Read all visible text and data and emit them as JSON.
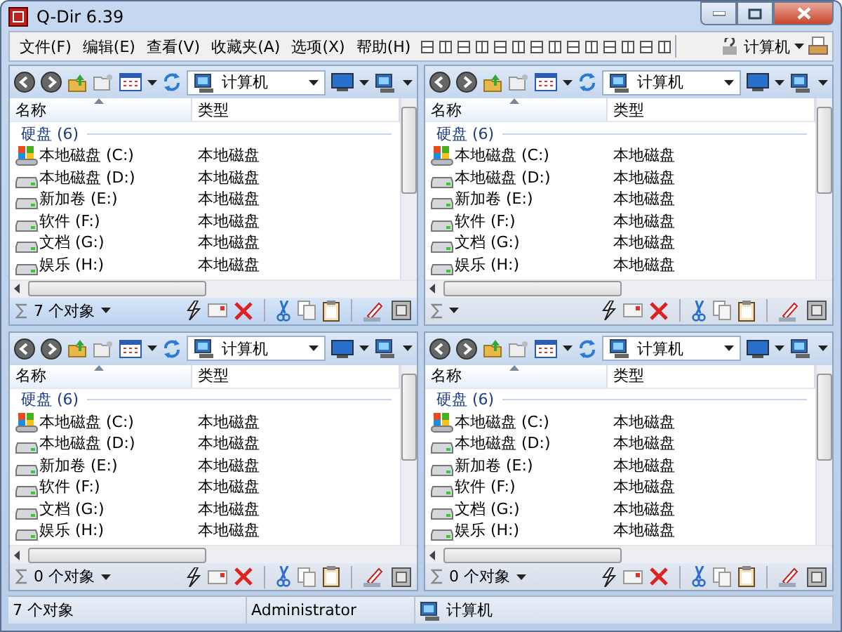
{
  "window": {
    "title": "Q-Dir 6.39"
  },
  "menu": [
    {
      "label": "文件(F)"
    },
    {
      "label": "编辑(E)"
    },
    {
      "label": "查看(V)"
    },
    {
      "label": "收藏夹(A)"
    },
    {
      "label": "选项(X)"
    },
    {
      "label": "帮助(H)"
    }
  ],
  "view_switch": {
    "label": "计算机"
  },
  "panes": [
    {
      "selected": true,
      "address": "计算机",
      "columns": [
        "名称",
        "类型"
      ],
      "group": "硬盘 (6)",
      "count": "7 个对象",
      "rows": [
        {
          "name": "本地磁盘 (C:)",
          "type": "本地磁盘",
          "kind": "system"
        },
        {
          "name": "本地磁盘 (D:)",
          "type": "本地磁盘",
          "kind": "drive"
        },
        {
          "name": "新加卷 (E:)",
          "type": "本地磁盘",
          "kind": "drive"
        },
        {
          "name": "软件 (F:)",
          "type": "本地磁盘",
          "kind": "drive"
        },
        {
          "name": "文档 (G:)",
          "type": "本地磁盘",
          "kind": "drive"
        },
        {
          "name": "娱乐 (H:)",
          "type": "本地磁盘",
          "kind": "drive"
        }
      ]
    },
    {
      "selected": false,
      "address": "计算机",
      "columns": [
        "名称",
        "类型"
      ],
      "group": "硬盘 (6)",
      "rows": [
        {
          "name": "本地磁盘 (C:)",
          "type": "本地磁盘",
          "kind": "system"
        },
        {
          "name": "本地磁盘 (D:)",
          "type": "本地磁盘",
          "kind": "drive"
        },
        {
          "name": "新加卷 (E:)",
          "type": "本地磁盘",
          "kind": "drive"
        },
        {
          "name": "软件 (F:)",
          "type": "本地磁盘",
          "kind": "drive"
        },
        {
          "name": "文档 (G:)",
          "type": "本地磁盘",
          "kind": "drive"
        },
        {
          "name": "娱乐 (H:)",
          "type": "本地磁盘",
          "kind": "drive"
        }
      ]
    },
    {
      "selected": false,
      "address": "计算机",
      "columns": [
        "名称",
        "类型"
      ],
      "group": "硬盘 (6)",
      "count": "0 个对象",
      "rows": [
        {
          "name": "本地磁盘 (C:)",
          "type": "本地磁盘",
          "kind": "system"
        },
        {
          "name": "本地磁盘 (D:)",
          "type": "本地磁盘",
          "kind": "drive"
        },
        {
          "name": "新加卷 (E:)",
          "type": "本地磁盘",
          "kind": "drive"
        },
        {
          "name": "软件 (F:)",
          "type": "本地磁盘",
          "kind": "drive"
        },
        {
          "name": "文档 (G:)",
          "type": "本地磁盘",
          "kind": "drive"
        },
        {
          "name": "娱乐 (H:)",
          "type": "本地磁盘",
          "kind": "drive"
        }
      ]
    },
    {
      "selected": false,
      "address": "计算机",
      "columns": [
        "名称",
        "类型"
      ],
      "group": "硬盘 (6)",
      "count": "0 个对象",
      "rows": [
        {
          "name": "本地磁盘 (C:)",
          "type": "本地磁盘",
          "kind": "system"
        },
        {
          "name": "本地磁盘 (D:)",
          "type": "本地磁盘",
          "kind": "drive"
        },
        {
          "name": "新加卷 (E:)",
          "type": "本地磁盘",
          "kind": "drive"
        },
        {
          "name": "软件 (F:)",
          "type": "本地磁盘",
          "kind": "drive"
        },
        {
          "name": "文档 (G:)",
          "type": "本地磁盘",
          "kind": "drive"
        },
        {
          "name": "娱乐 (H:)",
          "type": "本地磁盘",
          "kind": "drive"
        }
      ]
    }
  ],
  "status_bar": {
    "count": "7 个对象",
    "user": "Administrator",
    "location": "计算机"
  }
}
